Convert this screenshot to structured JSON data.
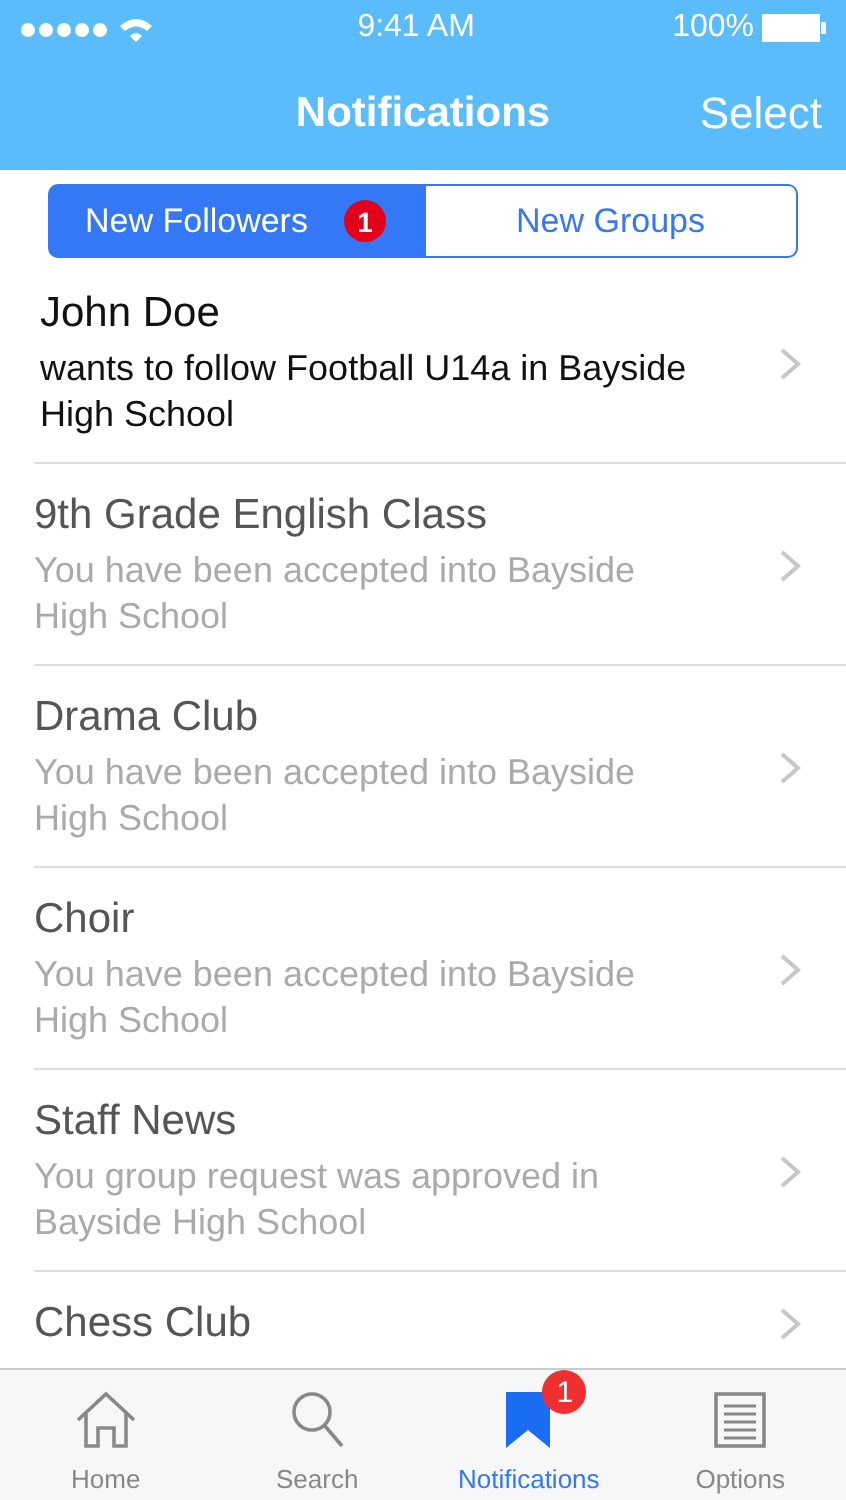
{
  "status_bar": {
    "time": "9:41 AM",
    "battery": "100%"
  },
  "nav": {
    "title": "Notifications",
    "action": "Select"
  },
  "segments": [
    {
      "label": "New Followers",
      "selected": true,
      "badge": "1"
    },
    {
      "label": "New Groups",
      "selected": false
    }
  ],
  "notifications": [
    {
      "title": "John Doe",
      "message": "wants to follow Football U14a in Bayside High School",
      "read": false
    },
    {
      "title": "9th Grade English Class",
      "message": "You have been accepted into Bayside High School",
      "read": true
    },
    {
      "title": "Drama Club",
      "message": "You have been accepted into Bayside High School",
      "read": true
    },
    {
      "title": "Choir",
      "message": "You have been accepted into Bayside High School",
      "read": true
    },
    {
      "title": "Staff News",
      "message": "You group request was approved in Bayside High School",
      "read": true
    },
    {
      "title": "Chess Club",
      "read": true
    }
  ],
  "tab_bar": [
    {
      "label": "Home",
      "kind": "home",
      "selected": false
    },
    {
      "label": "Search",
      "kind": "search",
      "selected": false
    },
    {
      "label": "Notifications",
      "kind": "bookmark",
      "selected": true,
      "badge": "1"
    },
    {
      "label": "Options",
      "kind": "list",
      "selected": false
    }
  ]
}
